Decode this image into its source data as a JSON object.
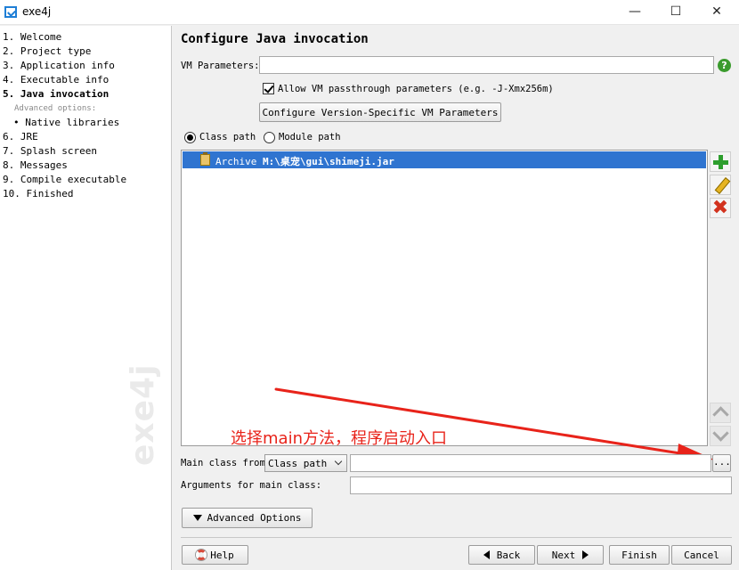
{
  "window": {
    "title": "exe4j",
    "controls": {
      "minimize": "—",
      "maximize": "☐",
      "close": "✕"
    }
  },
  "sidebar": {
    "steps": [
      {
        "label": "1. Welcome"
      },
      {
        "label": "2. Project type"
      },
      {
        "label": "3. Application info"
      },
      {
        "label": "4. Executable info"
      },
      {
        "label": "5. Java invocation"
      },
      {
        "label": "6. JRE"
      },
      {
        "label": "7. Splash screen"
      },
      {
        "label": "8. Messages"
      },
      {
        "label": "9. Compile executable"
      },
      {
        "label": "10. Finished"
      }
    ],
    "advanced_options_label": "Advanced options:",
    "sub_steps": [
      {
        "label": "• Native libraries"
      }
    ],
    "watermark": "exe4j"
  },
  "main": {
    "title": "Configure Java invocation",
    "vm_parameters": {
      "label": "VM Parameters:",
      "value": ""
    },
    "help_icon": "?",
    "passthrough": {
      "label": "Allow VM passthrough parameters (e.g. -J-Xmx256m)",
      "checked": true
    },
    "configure_button": "Configure Version-Specific VM Parameters",
    "path_mode": {
      "class_path": "Class path",
      "module_path": "Module path",
      "selected": "class_path"
    },
    "classpath_entries": [
      {
        "type": "Archive",
        "path": "M:\\桌宠\\gui\\shimeji.jar"
      }
    ],
    "annotation": "选择main方法，程序启动入口",
    "main_class": {
      "label": "Main class from",
      "source": "Class path",
      "value": "",
      "browse": "..."
    },
    "arguments": {
      "label": "Arguments for main class:",
      "value": ""
    },
    "advanced_button": "Advanced Options"
  },
  "footer": {
    "help": "Help",
    "back": "Back",
    "next": "Next",
    "finish": "Finish",
    "cancel": "Cancel"
  },
  "colors": {
    "selection": "#2f74d0",
    "annotation": "#e8231a",
    "add_icon": "#2d9e2d",
    "remove_icon": "#d2321e"
  }
}
